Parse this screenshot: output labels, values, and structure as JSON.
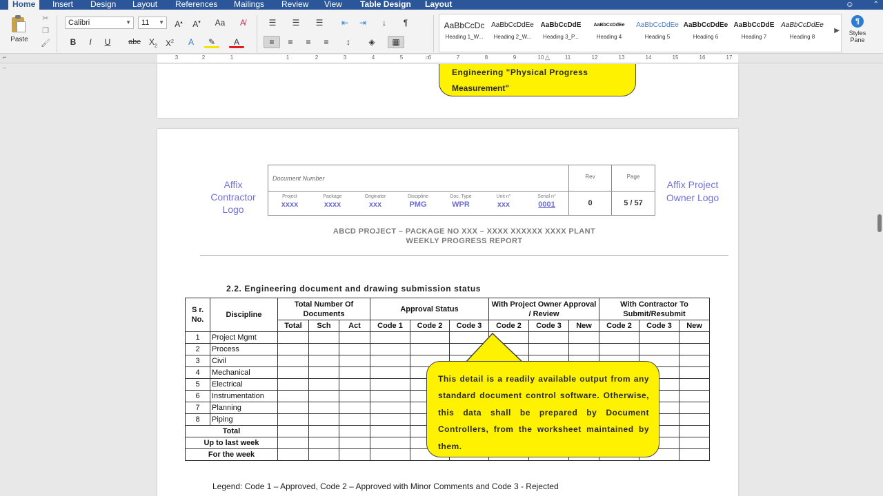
{
  "ribbon": {
    "tabs": [
      "Home",
      "Insert",
      "Design",
      "Layout",
      "References",
      "Mailings",
      "Review",
      "View",
      "Table Design",
      "Layout"
    ],
    "paste_label": "Paste",
    "font_name": "Calibri",
    "font_size": "11",
    "styles": [
      {
        "sample": "AaBbCcDc",
        "name": "Heading 1_W..."
      },
      {
        "sample": "AaBbCcDdEe",
        "name": "Heading 2_W..."
      },
      {
        "sample": "AaBbCcDdE",
        "name": "Heading 3_P..."
      },
      {
        "sample": "AaBbCcDdEe",
        "name": "Heading 4"
      },
      {
        "sample": "AaBbCcDdEe",
        "name": "Heading 5"
      },
      {
        "sample": "AaBbCcDdEe",
        "name": "Heading 6"
      },
      {
        "sample": "AaBbCcDdE",
        "name": "Heading 7"
      },
      {
        "sample": "AaBbCcDdEe",
        "name": "Heading 8"
      }
    ],
    "styles_pane_label": "Styles Pane"
  },
  "ruler": {
    "numbers": [
      "3",
      "2",
      "1",
      "1",
      "2",
      "3",
      "4",
      "5",
      "6",
      "7",
      "8",
      "9",
      "10",
      "11",
      "12",
      "13",
      "14",
      "15",
      "16",
      "17"
    ]
  },
  "page1": {
    "callout_line1": "Engineering  \"Physical  Progress",
    "callout_line2": "Measurement\""
  },
  "header": {
    "contractor_logo": "Affix Contractor Logo",
    "owner_logo": "Affix Project Owner Logo",
    "doc_number_label": "Document Number",
    "rev_label": "Rev",
    "page_label": "Page",
    "rev_value": "0",
    "page_value": "5 / 57",
    "fields": [
      {
        "label": "Project",
        "value": "xxxx"
      },
      {
        "label": "Package",
        "value": "xxxx"
      },
      {
        "label": "Originator",
        "value": "xxx"
      },
      {
        "label": "Discipline",
        "value": "PMG"
      },
      {
        "label": "Doc. Type",
        "value": "WPR"
      },
      {
        "label": "Unit n°",
        "value": "xxx"
      },
      {
        "label": "Serial n°",
        "value": "0001"
      }
    ]
  },
  "report": {
    "title_line1": "ABCD PROJECT – PACKAGE NO XXX – XXXX XXXXXX XXXX PLANT",
    "title_line2": "WEEKLY PROGRESS REPORT",
    "section": "2.2. Engineering document and drawing submission status"
  },
  "table": {
    "headers": {
      "sr_no": "S r. No.",
      "discipline": "Discipline",
      "total_docs": "Total Number Of Documents",
      "approval_status": "Approval Status",
      "with_owner": "With Project Owner Approval / Review",
      "with_contractor": "With Contractor To Submit/Resubmit"
    },
    "subheaders": [
      "Total",
      "Sch",
      "Act",
      "Code 1",
      "Code 2",
      "Code 3",
      "Code 2",
      "Code 3",
      "New",
      "Code 2",
      "Code 3",
      "New"
    ],
    "rows": [
      {
        "no": "1",
        "discipline": "Project Mgmt"
      },
      {
        "no": "2",
        "discipline": "Process"
      },
      {
        "no": "3",
        "discipline": "Civil"
      },
      {
        "no": "4",
        "discipline": "Mechanical"
      },
      {
        "no": "5",
        "discipline": "Electrical"
      },
      {
        "no": "6",
        "discipline": "Instrumentation"
      },
      {
        "no": "7",
        "discipline": "Planning"
      },
      {
        "no": "8",
        "discipline": "Piping"
      }
    ],
    "summary_rows": [
      "Total",
      "Up to last week",
      "For the week"
    ]
  },
  "callout_main": "This detail is a readily available output from any standard document control software. Otherwise, this data shall be prepared by Document Controllers, from the worksheet maintained by them.",
  "legend": "Legend:  Code 1 – Approved,  Code 2 – Approved with Minor Comments and Code 3 - Rejected",
  "colors": {
    "ribbon_blue": "#2b579a",
    "callout_yellow": "#fef200",
    "logo_purple": "#7070d8"
  }
}
